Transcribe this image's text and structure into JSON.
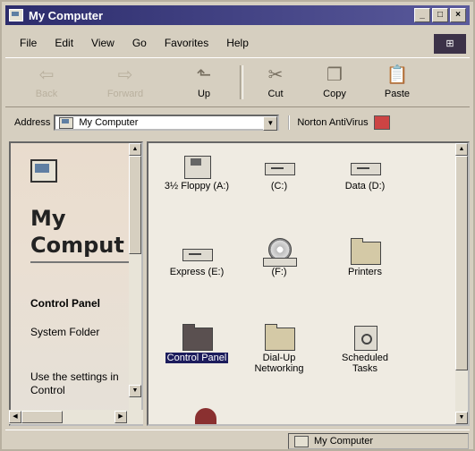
{
  "window": {
    "title": "My Computer",
    "controls": {
      "minimize": "_",
      "maximize": "□",
      "close": "×"
    }
  },
  "menubar": {
    "items": [
      "File",
      "Edit",
      "View",
      "Go",
      "Favorites",
      "Help"
    ]
  },
  "toolbar": {
    "back": {
      "label": "Back",
      "icon": "back-arrow-icon",
      "glyph": "⇦"
    },
    "forward": {
      "label": "Forward",
      "icon": "forward-arrow-icon",
      "glyph": "⇨"
    },
    "up": {
      "label": "Up",
      "icon": "up-folder-icon",
      "glyph": "⬑"
    },
    "cut": {
      "label": "Cut",
      "icon": "scissors-icon",
      "glyph": "✂"
    },
    "copy": {
      "label": "Copy",
      "icon": "copy-icon",
      "glyph": "❐"
    },
    "paste": {
      "label": "Paste",
      "icon": "paste-icon",
      "glyph": "📋"
    }
  },
  "address": {
    "label": "Address",
    "value": "My Computer",
    "norton": "Norton AntiVirus"
  },
  "left_pane": {
    "title_line1": "My",
    "title_line2": "Comput",
    "selected_name": "Control Panel",
    "selected_type": "System Folder",
    "description": "Use the settings in Control"
  },
  "items": [
    {
      "label": "3½ Floppy (A:)",
      "icon": "floppy-drive-icon"
    },
    {
      "label": "(C:)",
      "icon": "hard-drive-icon"
    },
    {
      "label": "Data (D:)",
      "icon": "hard-drive-icon"
    },
    {
      "label": "Express (E:)",
      "icon": "hard-drive-icon"
    },
    {
      "label": "(F:)",
      "icon": "cd-drive-icon"
    },
    {
      "label": "Printers",
      "icon": "printer-folder-icon"
    },
    {
      "label": "Control Panel",
      "icon": "control-panel-icon",
      "selected": true
    },
    {
      "label": "Dial-Up Networking",
      "icon": "dialup-icon"
    },
    {
      "label": "Scheduled Tasks",
      "icon": "scheduled-tasks-icon"
    }
  ],
  "status": {
    "location": "My Computer"
  }
}
